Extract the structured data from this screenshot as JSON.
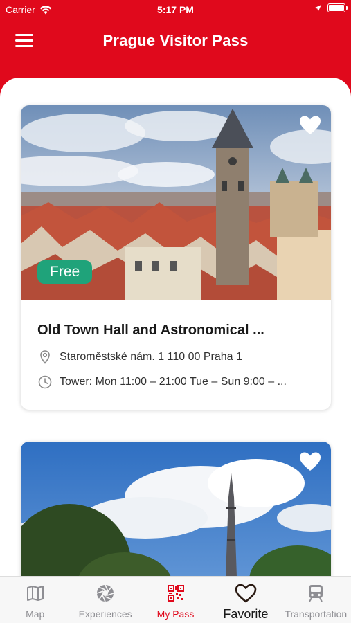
{
  "status_bar": {
    "carrier": "Carrier",
    "time": "5:17 PM",
    "battery_level": 1.0
  },
  "nav": {
    "title": "Prague Visitor Pass",
    "menu_icon": "hamburger-menu-icon"
  },
  "cards": [
    {
      "badge": "Free",
      "title": "Old Town Hall and Astronomical ...",
      "address": "Staroměstské nám. 1  110 00 Praha 1",
      "hours": "Tower:  Mon 11:00 – 21:00  Tue – Sun 9:00 – ...",
      "favorite_icon": "heart-icon",
      "address_icon": "location-pin-icon",
      "hours_icon": "clock-icon"
    },
    {
      "favorite_icon": "heart-icon"
    }
  ],
  "tabs": [
    {
      "label": "Map",
      "icon": "map-icon"
    },
    {
      "label": "Experiences",
      "icon": "aperture-icon"
    },
    {
      "label": "My Pass",
      "icon": "qr-code-icon",
      "active": true
    },
    {
      "label": "Favorite",
      "icon": "heart-outline-icon"
    },
    {
      "label": "Transportation",
      "icon": "train-icon"
    }
  ],
  "colors": {
    "brand": "#e0091c",
    "badge": "#1fa37a",
    "tab_inactive": "#8e8e93"
  }
}
